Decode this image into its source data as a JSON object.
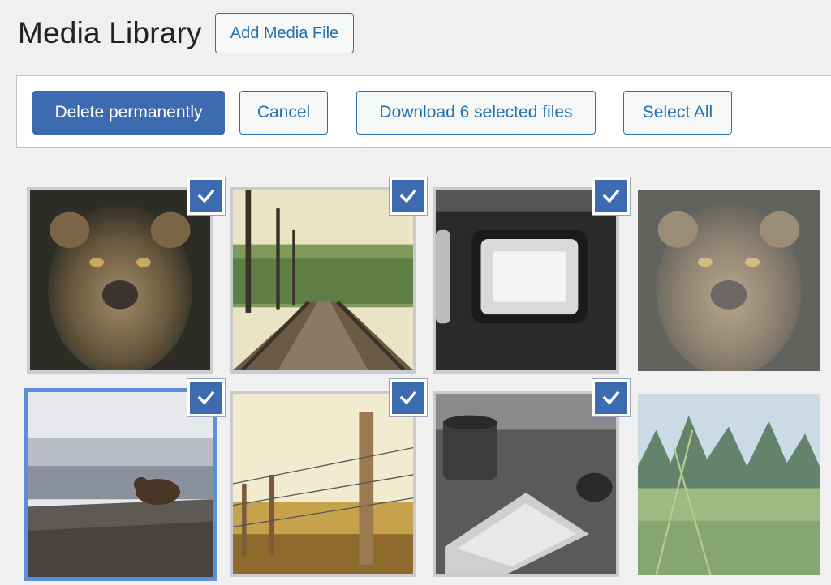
{
  "header": {
    "title": "Media Library",
    "add_button": "Add Media File"
  },
  "toolbar": {
    "delete_label": "Delete permanently",
    "cancel_label": "Cancel",
    "download_label": "Download 6 selected files",
    "select_all_label": "Select All"
  },
  "colors": {
    "primary": "#3d6bb0",
    "link": "#2271b1",
    "background": "#f0f0f1",
    "focus": "#5b8fd8"
  },
  "media_items": [
    {
      "subject": "lioness",
      "selected": true
    },
    {
      "subject": "railway-tracks",
      "selected": true
    },
    {
      "subject": "train-window",
      "selected": true
    },
    {
      "subject": "lioness",
      "selected": false
    },
    {
      "subject": "bear",
      "selected": true
    },
    {
      "subject": "fence-post",
      "selected": true
    },
    {
      "subject": "coffee-keyboard",
      "selected": true
    },
    {
      "subject": "grass-field",
      "selected": false
    }
  ]
}
